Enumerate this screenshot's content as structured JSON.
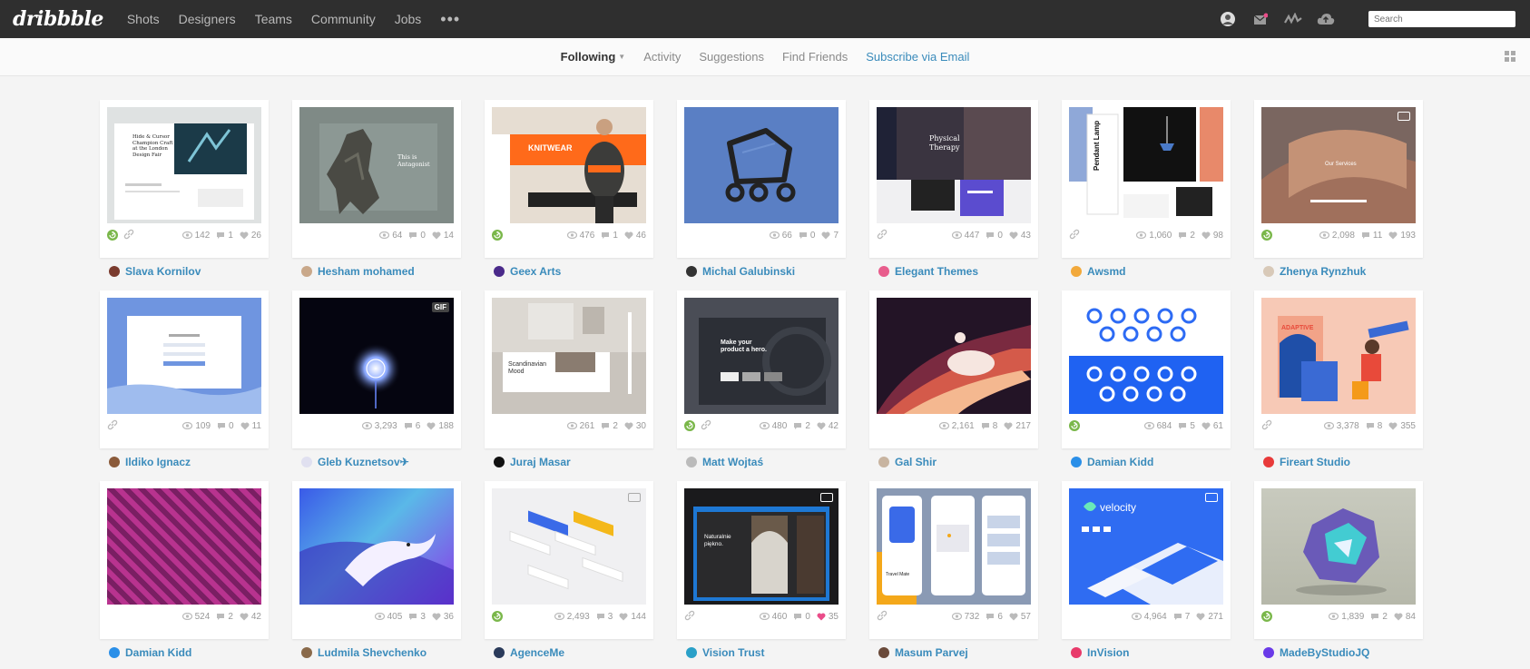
{
  "header": {
    "logo": "dribbble",
    "nav": [
      "Shots",
      "Designers",
      "Teams",
      "Community",
      "Jobs"
    ],
    "more_icon": "ellipsis-icon",
    "icons": [
      "avatar",
      "mail-icon",
      "activity-icon",
      "upload-icon"
    ],
    "search_placeholder": "Search"
  },
  "subnav": {
    "following": "Following",
    "activity": "Activity",
    "suggestions": "Suggestions",
    "find_friends": "Find Friends",
    "subscribe": "Subscribe via Email"
  },
  "shots": [
    {
      "views": "142",
      "comments": "1",
      "likes": "26",
      "author": "Slava Kornilov",
      "rebound": true,
      "link": true,
      "liked": false,
      "badge": "",
      "avatar_color": "#7a3b2e"
    },
    {
      "views": "64",
      "comments": "0",
      "likes": "14",
      "author": "Hesham mohamed",
      "rebound": false,
      "link": false,
      "liked": false,
      "badge": "",
      "avatar_color": "#c9a88a"
    },
    {
      "views": "476",
      "comments": "1",
      "likes": "46",
      "author": "Geex Arts",
      "rebound": true,
      "link": false,
      "liked": false,
      "badge": "",
      "avatar_color": "#4a2a8a"
    },
    {
      "views": "66",
      "comments": "0",
      "likes": "7",
      "author": "Michal Galubinski",
      "rebound": false,
      "link": false,
      "liked": false,
      "badge": "",
      "avatar_color": "#333333"
    },
    {
      "views": "447",
      "comments": "0",
      "likes": "43",
      "author": "Elegant Themes",
      "rebound": false,
      "link": true,
      "liked": false,
      "badge": "",
      "avatar_color": "#e85d8c"
    },
    {
      "views": "1,060",
      "comments": "2",
      "likes": "98",
      "author": "Awsmd",
      "rebound": false,
      "link": true,
      "liked": false,
      "badge": "",
      "avatar_color": "#f2a93b"
    },
    {
      "views": "2,098",
      "comments": "11",
      "likes": "193",
      "author": "Zhenya Rynzhuk",
      "rebound": true,
      "link": false,
      "liked": false,
      "badge": "video",
      "avatar_color": "#d8c9b8"
    },
    {
      "views": "109",
      "comments": "0",
      "likes": "11",
      "author": "Ildiko Ignacz",
      "rebound": false,
      "link": true,
      "liked": false,
      "badge": "",
      "avatar_color": "#8a5a3a"
    },
    {
      "views": "3,293",
      "comments": "6",
      "likes": "188",
      "author": "Gleb Kuznetsov✈",
      "rebound": false,
      "link": false,
      "liked": false,
      "badge": "GIF",
      "avatar_color": "#e0e0f0"
    },
    {
      "views": "261",
      "comments": "2",
      "likes": "30",
      "author": "Juraj Masar",
      "rebound": false,
      "link": false,
      "liked": false,
      "badge": "",
      "avatar_color": "#111111"
    },
    {
      "views": "480",
      "comments": "2",
      "likes": "42",
      "author": "Matt Wojtaś",
      "rebound": true,
      "link": true,
      "liked": false,
      "badge": "",
      "avatar_color": "#bbbbbb"
    },
    {
      "views": "2,161",
      "comments": "8",
      "likes": "217",
      "author": "Gal Shir",
      "rebound": false,
      "link": false,
      "liked": false,
      "badge": "",
      "avatar_color": "#c8b4a0"
    },
    {
      "views": "684",
      "comments": "5",
      "likes": "61",
      "author": "Damian Kidd",
      "rebound": true,
      "link": false,
      "liked": false,
      "badge": "",
      "avatar_color": "#2a8fe8"
    },
    {
      "views": "3,378",
      "comments": "8",
      "likes": "355",
      "author": "Fireart Studio",
      "rebound": false,
      "link": true,
      "liked": false,
      "badge": "",
      "avatar_color": "#e83a3a"
    },
    {
      "views": "524",
      "comments": "2",
      "likes": "42",
      "author": "Damian Kidd",
      "rebound": false,
      "link": false,
      "liked": false,
      "badge": "",
      "avatar_color": "#2a8fe8"
    },
    {
      "views": "405",
      "comments": "3",
      "likes": "36",
      "author": "Ludmila Shevchenko",
      "rebound": false,
      "link": false,
      "liked": false,
      "badge": "",
      "avatar_color": "#8a6a4a"
    },
    {
      "views": "2,493",
      "comments": "3",
      "likes": "144",
      "author": "AgenceMe",
      "rebound": true,
      "link": false,
      "liked": false,
      "badge": "video-dark",
      "avatar_color": "#2a3a5a"
    },
    {
      "views": "460",
      "comments": "0",
      "likes": "35",
      "author": "Vision Trust",
      "rebound": false,
      "link": true,
      "liked": true,
      "badge": "video",
      "avatar_color": "#2aa0c8"
    },
    {
      "views": "732",
      "comments": "6",
      "likes": "57",
      "author": "Masum Parvej",
      "rebound": false,
      "link": true,
      "liked": false,
      "badge": "",
      "avatar_color": "#6a4a3a"
    },
    {
      "views": "4,964",
      "comments": "7",
      "likes": "271",
      "author": "InVision",
      "rebound": false,
      "link": false,
      "liked": false,
      "badge": "video",
      "avatar_color": "#e83a6a"
    },
    {
      "views": "1,839",
      "comments": "2",
      "likes": "84",
      "author": "MadeByStudioJQ",
      "rebound": true,
      "link": false,
      "liked": false,
      "badge": "",
      "avatar_color": "#6a3ae8"
    }
  ],
  "thumb_text": {
    "t1": "Hide & Cursor Champion Craft at the London Design Fair",
    "t2": "This is Antagonist",
    "t3": "KNITWEAR",
    "t5": "Physical Therapy",
    "t6": "Pendant Lamp",
    "t7": "Our Services",
    "t10": "Scandinavian Mood",
    "t11": "Make your product a hero.",
    "t13a": "ADAPTIVE",
    "t17": "Naturalnie piękno.",
    "t19": "Travel Mate",
    "t20": "velocity"
  }
}
